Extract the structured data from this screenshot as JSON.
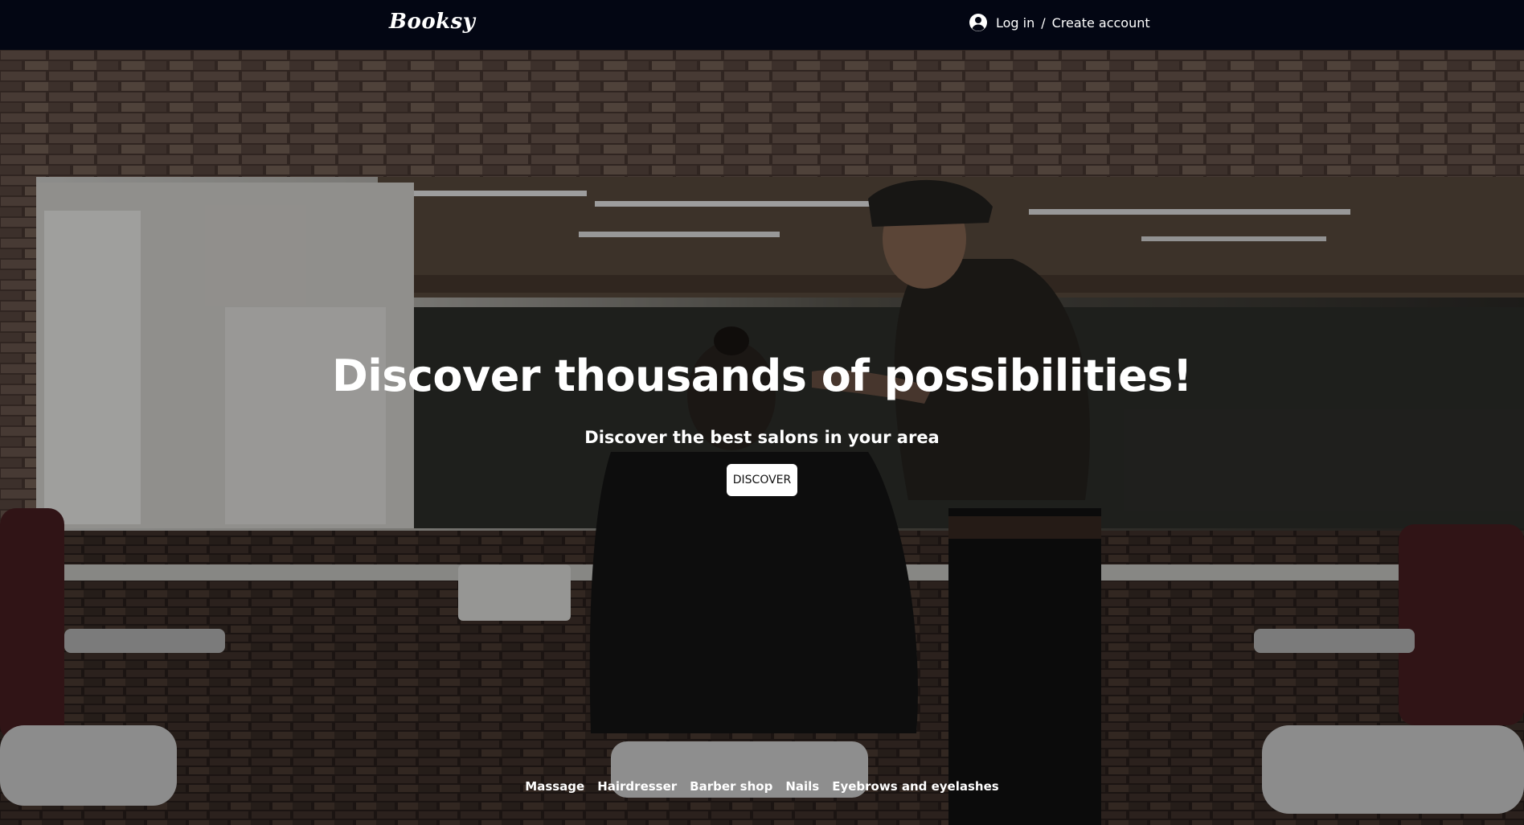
{
  "header": {
    "logo": "Booksy",
    "login_label": "Log in",
    "separator": "/",
    "create_account_label": "Create account",
    "user_icon": "account-circle-icon",
    "background": "#030613"
  },
  "hero": {
    "title": "Discover thousands of possibilities!",
    "subtitle": "Discover the best salons in your area",
    "button_label": "DISCOVER",
    "background_image": "barbershop-photo"
  },
  "categories": [
    {
      "label": "Massage"
    },
    {
      "label": "Hairdresser"
    },
    {
      "label": "Barber shop"
    },
    {
      "label": "Nails"
    },
    {
      "label": "Eyebrows and eyelashes"
    }
  ]
}
